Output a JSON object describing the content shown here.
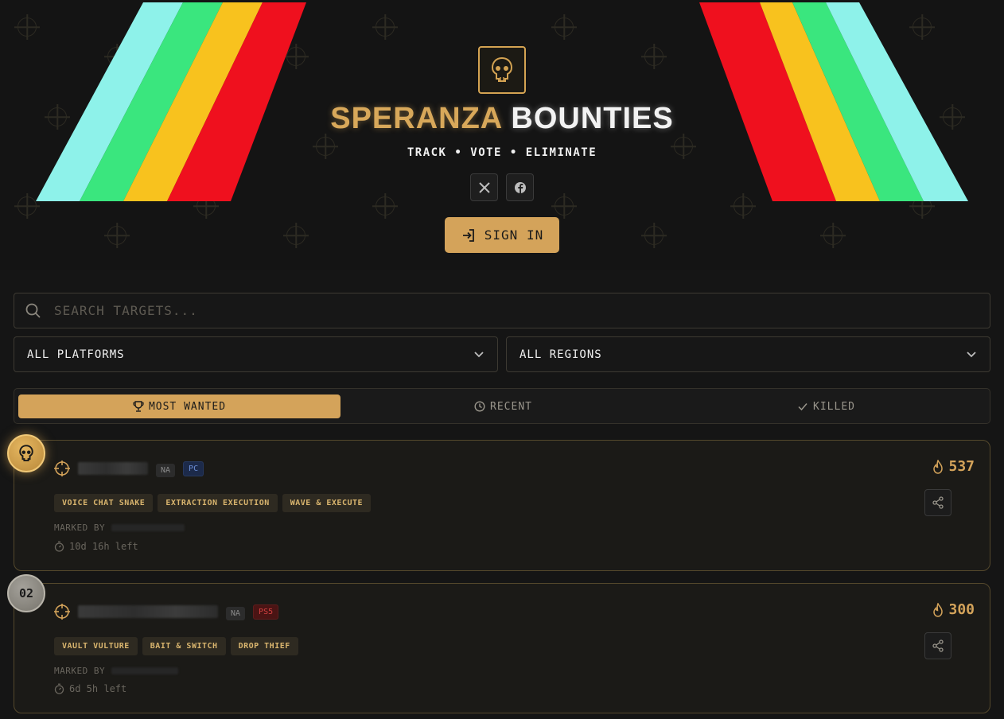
{
  "header": {
    "title_part1": "SPERANZA",
    "title_part2": "BOUNTIES",
    "tagline": "TRACK • VOTE • ELIMINATE",
    "logo_icon": "skull-icon",
    "social": [
      {
        "name": "x-icon"
      },
      {
        "name": "facebook-icon"
      }
    ],
    "sign_in_label": "SIGN IN",
    "stripe_colors": [
      "#8ef2ea",
      "#3ae67e",
      "#f8c21e",
      "#ef101e"
    ]
  },
  "search": {
    "placeholder": "SEARCH TARGETS..."
  },
  "filters": {
    "platform": "ALL PLATFORMS",
    "region": "ALL REGIONS"
  },
  "tabs": [
    {
      "label": "MOST WANTED",
      "icon": "trophy-icon",
      "active": true
    },
    {
      "label": "RECENT",
      "icon": "clock-icon",
      "active": false
    },
    {
      "label": "KILLED",
      "icon": "check-icon",
      "active": false
    }
  ],
  "bounties": [
    {
      "rank_icon": "skull-icon",
      "rank": "",
      "region": "NA",
      "platform": "PC",
      "tags": [
        "VOICE CHAT SNAKE",
        "EXTRACTION EXECUTION",
        "WAVE & EXECUTE"
      ],
      "marked_by_label": "MARKED BY",
      "time_left": "10d 16h left",
      "votes": "537"
    },
    {
      "rank": "02",
      "region": "NA",
      "platform": "PS5",
      "tags": [
        "VAULT VULTURE",
        "BAIT & SWITCH",
        "DROP THIEF"
      ],
      "marked_by_label": "MARKED BY",
      "time_left": "6d 5h left",
      "votes": "300"
    }
  ],
  "colors": {
    "accent": "#d4a35a",
    "background": "#151515",
    "card_border": "#54482c"
  }
}
